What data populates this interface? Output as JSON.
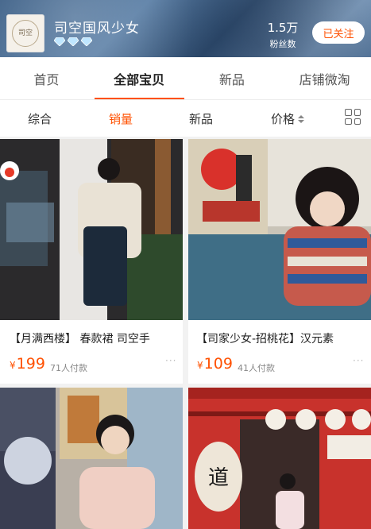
{
  "shop": {
    "name": "司空国风少女",
    "logo_text": "司空",
    "fans_count": "1.5万",
    "fans_label": "粉丝数",
    "follow_label": "已关注",
    "diamond_count": 3
  },
  "tabs": [
    {
      "label": "首页",
      "active": false
    },
    {
      "label": "全部宝贝",
      "active": true
    },
    {
      "label": "新品",
      "active": false
    },
    {
      "label": "店铺微淘",
      "active": false
    }
  ],
  "sort": {
    "items": [
      {
        "label": "综合",
        "active": false
      },
      {
        "label": "销量",
        "active": true
      },
      {
        "label": "新品",
        "active": false
      },
      {
        "label": "价格",
        "active": false
      }
    ]
  },
  "products": [
    {
      "title": "【月满西楼】 春款裙 司空手",
      "currency": "¥",
      "price": "199",
      "sold": "71人付款",
      "more": "···"
    },
    {
      "title": "【司家少女-招桃花】汉元素",
      "currency": "¥",
      "price": "109",
      "sold": "41人付款",
      "more": "···"
    },
    {
      "title": "",
      "currency": "",
      "price": "",
      "sold": "",
      "more": ""
    },
    {
      "title": "",
      "currency": "",
      "price": "",
      "sold": "",
      "more": ""
    }
  ],
  "colors": {
    "accent": "#ff5000",
    "header_bg": "#4a6c92"
  }
}
